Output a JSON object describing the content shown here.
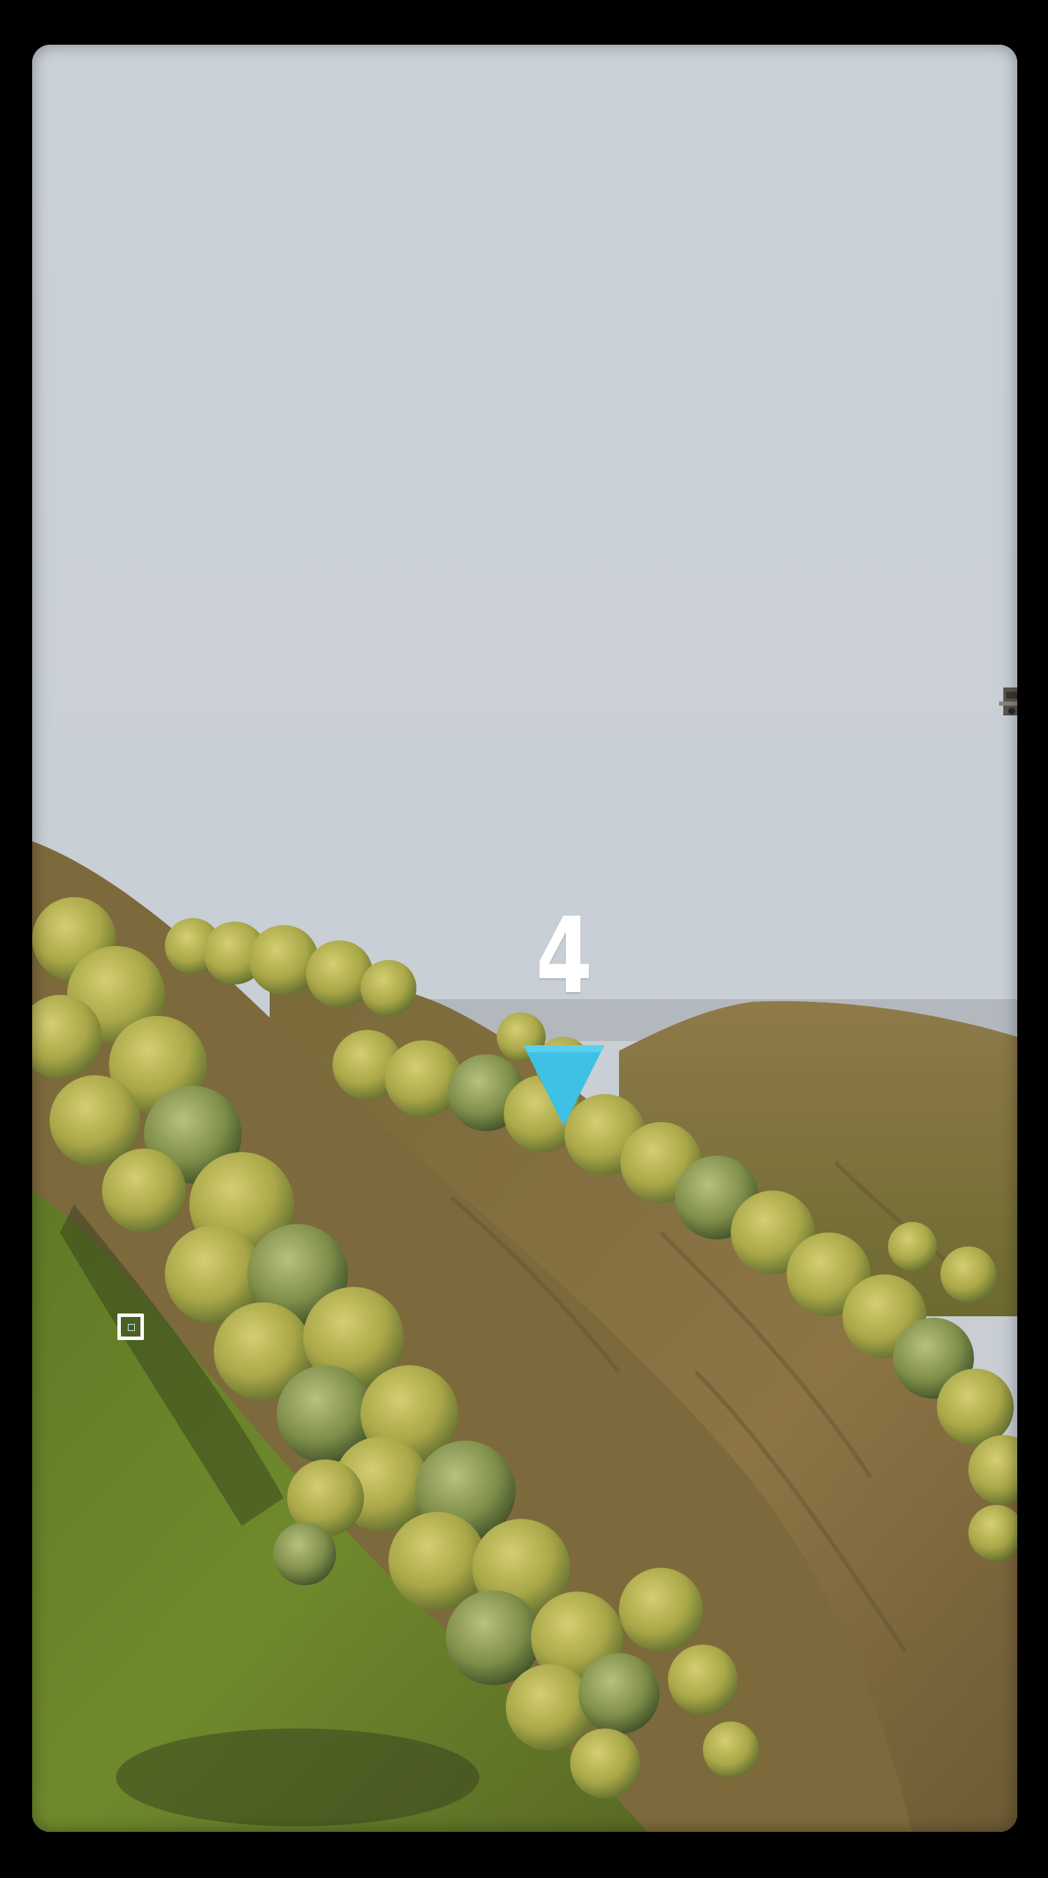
{
  "hud": {
    "checkpoint_number": "4",
    "marker_color": "#3ec1e4",
    "marker_icon": "down-arrow-icon",
    "reticle_icon": "crosshair-icon"
  },
  "scene": {
    "sky_color": "#c9cfd6",
    "haze_color": "#b3b8bf",
    "rock_color": "#8a7446",
    "foliage_color": "#a9a748",
    "grass_color": "#6f8a2c"
  }
}
